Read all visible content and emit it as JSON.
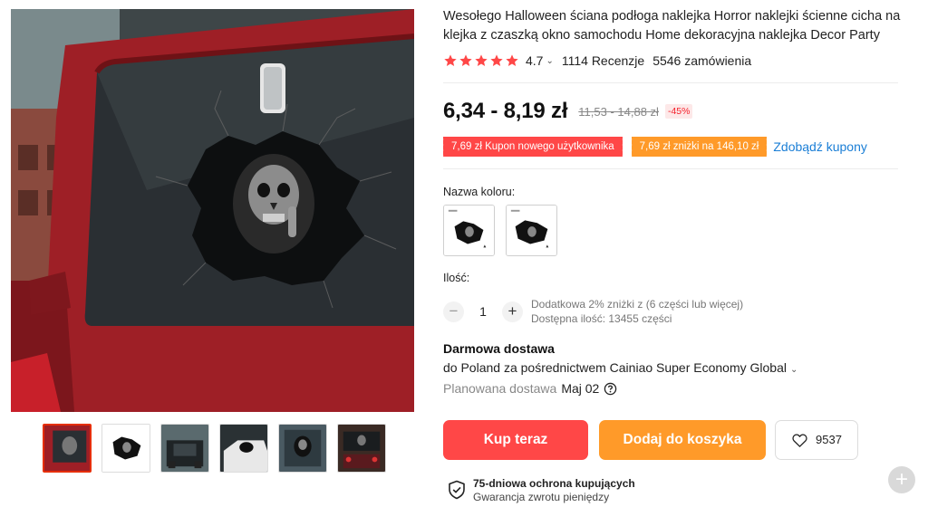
{
  "product": {
    "title": "Wesołego Halloween ściana podłoga naklejka Horror naklejki ścienne cicha na klejka z czaszką okno samochodu Home dekoracyjna naklejka Decor Party",
    "rating": "4.7",
    "rating_stars": 5,
    "reviews": "1114 Recenzje",
    "orders": "5546 zamówienia"
  },
  "price": {
    "current": "6,34 - 8,19 zł",
    "original": "11,53 - 14,88 zł",
    "discount": "-45%"
  },
  "coupons": {
    "new_user": "7,69 zł Kupon nowego użytkownika",
    "store": "7,69 zł zniżki na 146,10 zł",
    "get_link": "Zdobądź kupony"
  },
  "color": {
    "label": "Nazwa koloru:"
  },
  "quantity": {
    "label": "Ilość:",
    "minus": "−",
    "value": "1",
    "plus": "+",
    "discount_note": "Dodatkowa 2% zniżki z (6 części lub więcej)",
    "available": "Dostępna ilość: 13455 części"
  },
  "shipping": {
    "title": "Darmowa dostawa",
    "via": "do Poland za pośrednictwem Cainiao Super Economy Global",
    "planned_label": "Planowana dostawa",
    "planned_date": "Maj 02"
  },
  "actions": {
    "buy_now": "Kup teraz",
    "add_to_cart": "Dodaj do koszyka",
    "wishlist_count": "9537"
  },
  "guarantee": {
    "title": "75-dniowa ochrona kupujących",
    "subtitle": "Gwarancja zwrotu pieniędzy"
  },
  "colors": {
    "accent_red": "#ff4747",
    "accent_orange": "#ff9a29",
    "link_blue": "#1a7ed6",
    "star": "#ff4747"
  }
}
